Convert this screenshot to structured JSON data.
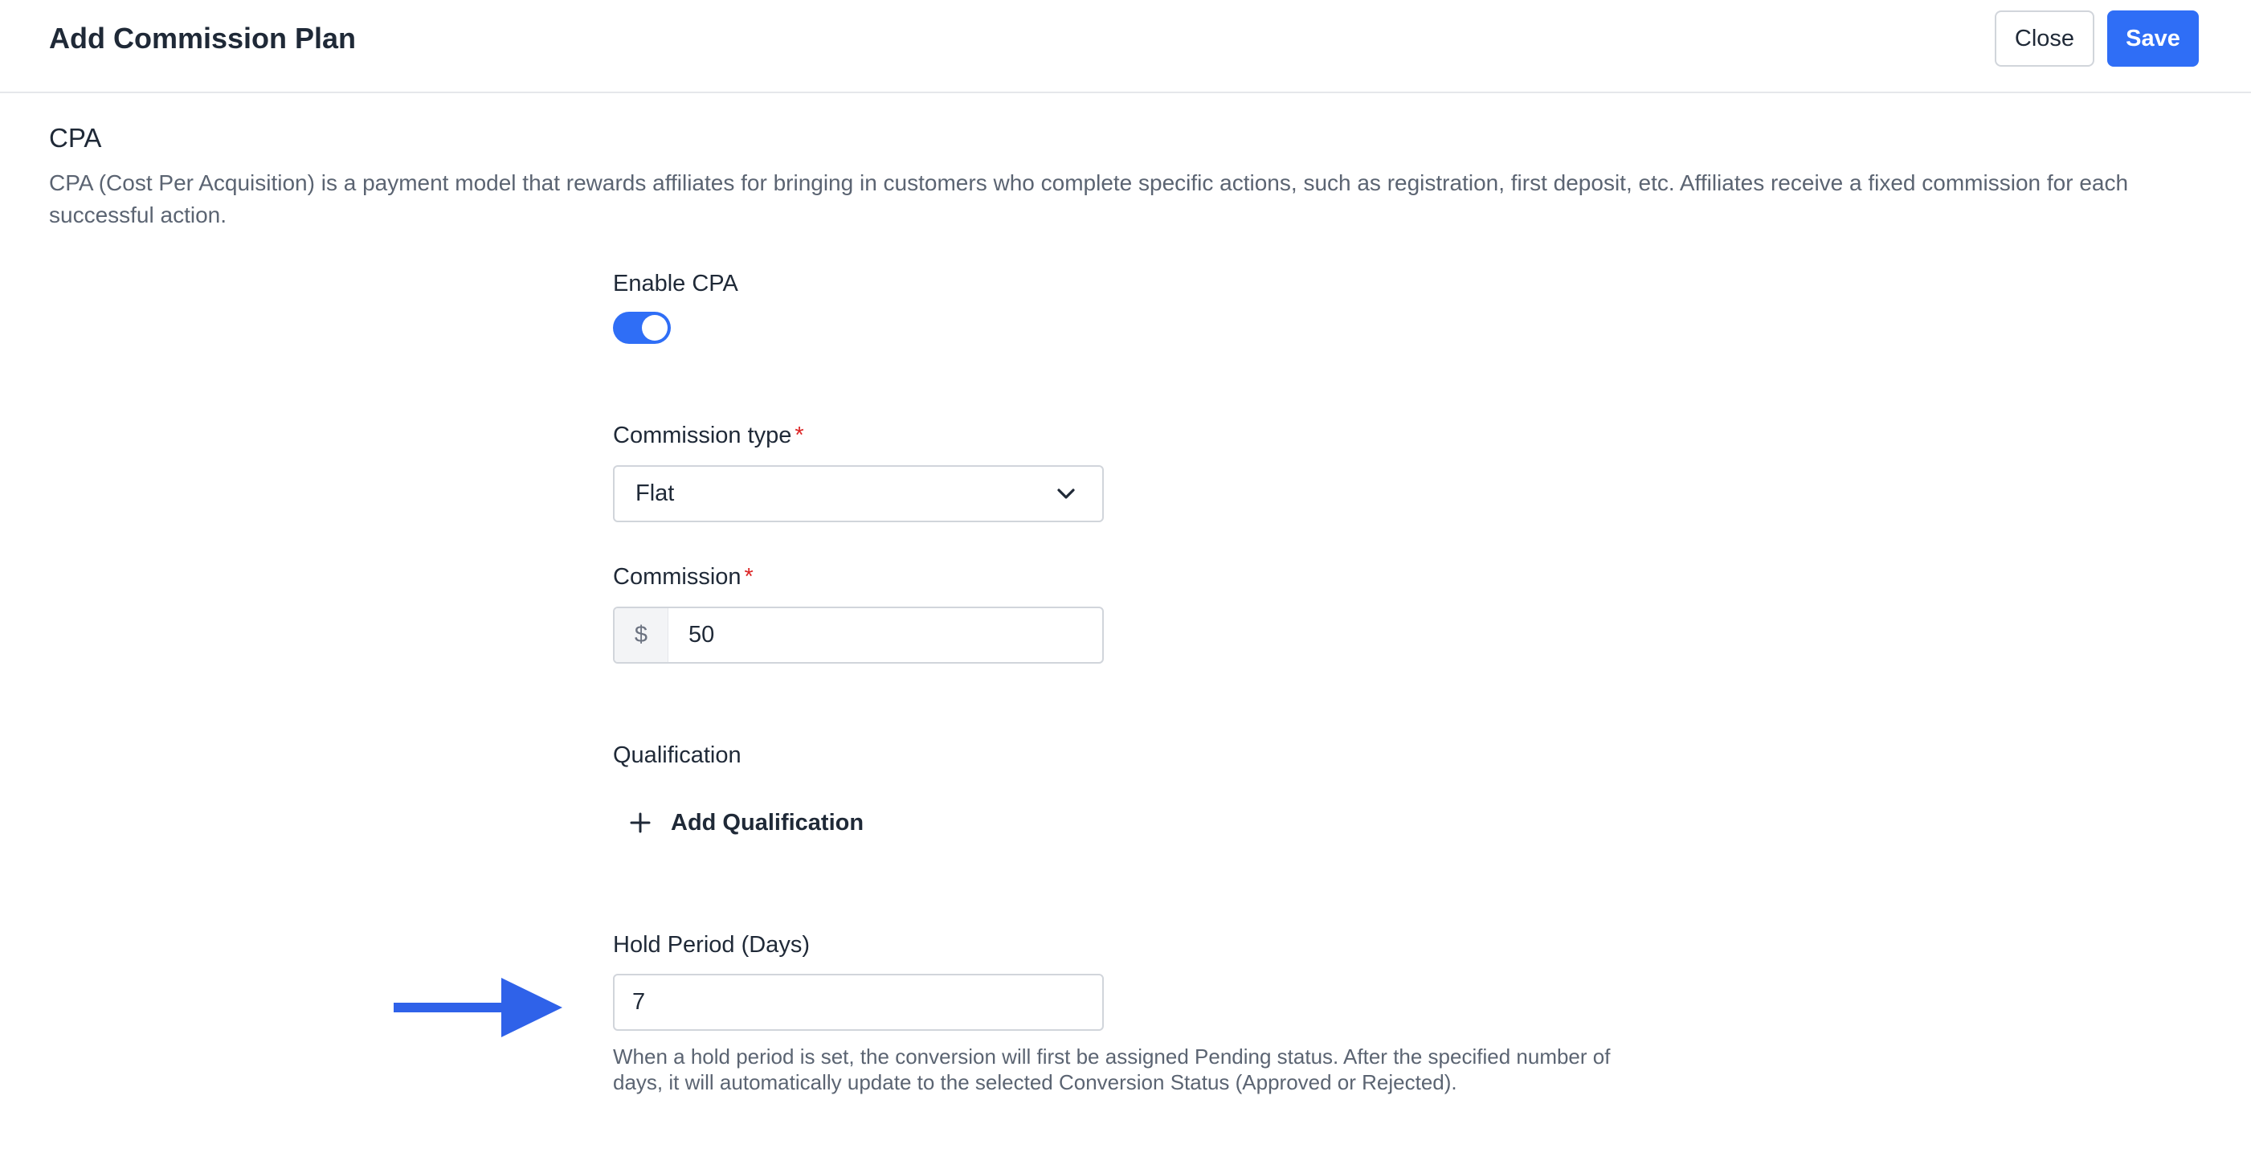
{
  "header": {
    "title": "Add Commission Plan",
    "close_label": "Close",
    "save_label": "Save",
    "accent_color": "#2f6ef6"
  },
  "section": {
    "title": "CPA",
    "description": "CPA (Cost Per Acquisition) is a payment model that rewards affiliates for bringing in customers who complete specific actions, such as registration, first deposit, etc. Affiliates receive a fixed commission for each successful action."
  },
  "form": {
    "enable_cpa": {
      "label": "Enable CPA",
      "enabled": true
    },
    "commission_type": {
      "label": "Commission type",
      "required_mark": "*",
      "value": "Flat",
      "icon": "chevron-down-icon"
    },
    "commission": {
      "label": "Commission",
      "required_mark": "*",
      "prefix": "$",
      "value": "50"
    },
    "qualification": {
      "label": "Qualification",
      "add_label": "Add Qualification",
      "icon": "plus-icon"
    },
    "hold_period": {
      "label": "Hold Period (Days)",
      "value": "7",
      "hint": "When a hold period is set, the conversion will first be assigned Pending status. After the specified number of days, it will automatically update to the selected Conversion Status (Approved or Rejected)."
    }
  },
  "annotation": {
    "icon": "arrow-right-icon",
    "color": "#2f62e9"
  }
}
